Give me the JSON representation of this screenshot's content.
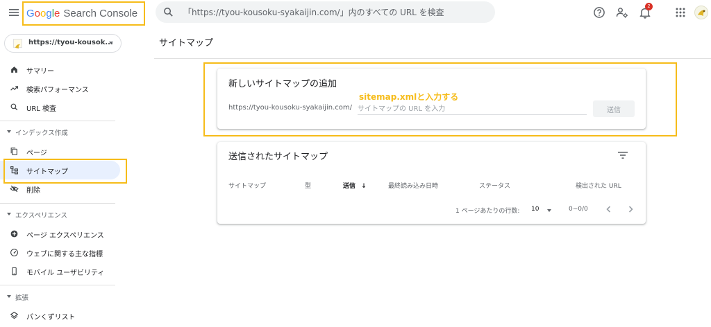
{
  "header": {
    "logo_google": "Google",
    "logo_product": "Search Console",
    "search_placeholder": "「https://tyou-kousoku-syakaijin.com/」内のすべての URL を検査",
    "notification_count": "2",
    "icons": [
      "menu-icon",
      "search-icon",
      "help-icon",
      "user-settings-icon",
      "notification-bell-icon",
      "apps-grid-icon",
      "account-avatar"
    ]
  },
  "property": {
    "label": "https://tyou-kousok...",
    "icon": "site-favicon"
  },
  "sidebar": {
    "items_top": [
      {
        "label": "サマリー",
        "icon": "home-icon"
      },
      {
        "label": "検索パフォーマンス",
        "icon": "trending-up-icon"
      },
      {
        "label": "URL 検査",
        "icon": "search-icon"
      }
    ],
    "section_index": {
      "label": "インデックス作成",
      "items": [
        {
          "label": "ページ",
          "icon": "pages-icon"
        },
        {
          "label": "サイトマップ",
          "icon": "sitemap-icon"
        },
        {
          "label": "削除",
          "icon": "remove-eye-icon"
        }
      ]
    },
    "section_experience": {
      "label": "エクスペリエンス",
      "items": [
        {
          "label": "ページ エクスペリエンス",
          "icon": "page-experience-icon"
        },
        {
          "label": "ウェブに関する主な指標",
          "icon": "speed-gauge-icon"
        },
        {
          "label": "モバイル ユーザビリティ",
          "icon": "smartphone-icon"
        }
      ]
    },
    "section_enhancements": {
      "label": "拡張",
      "items": [
        {
          "label": "パンくずリスト",
          "icon": "layers-icon"
        }
      ]
    }
  },
  "main": {
    "page_title": "サイトマップ",
    "add_card": {
      "title": "新しいサイトマップの追加",
      "annotation": "sitemap.xmlと入力する",
      "url_prefix": "https://tyou-kousoku-syakaijin.com/",
      "input_placeholder": "サイトマップの URL を入力",
      "input_value": "",
      "submit_label": "送信"
    },
    "list_card": {
      "title": "送信されたサイトマップ",
      "columns": [
        "サイトマップ",
        "型",
        "送信",
        "最終読み込み日時",
        "ステータス",
        "検出された URL"
      ],
      "sorted_column_arrow": "↓",
      "rows_per_page_label": "1 ページあたりの行数:",
      "rows_per_page_value": "10",
      "range_text": "0~0/0"
    }
  },
  "colors": {
    "highlight": "#f6bc1a",
    "active_nav_bg": "#e8f0fe",
    "google_blue": "#4285f4",
    "google_red": "#ea4335",
    "google_yellow": "#fbbc05",
    "google_green": "#34a853"
  }
}
